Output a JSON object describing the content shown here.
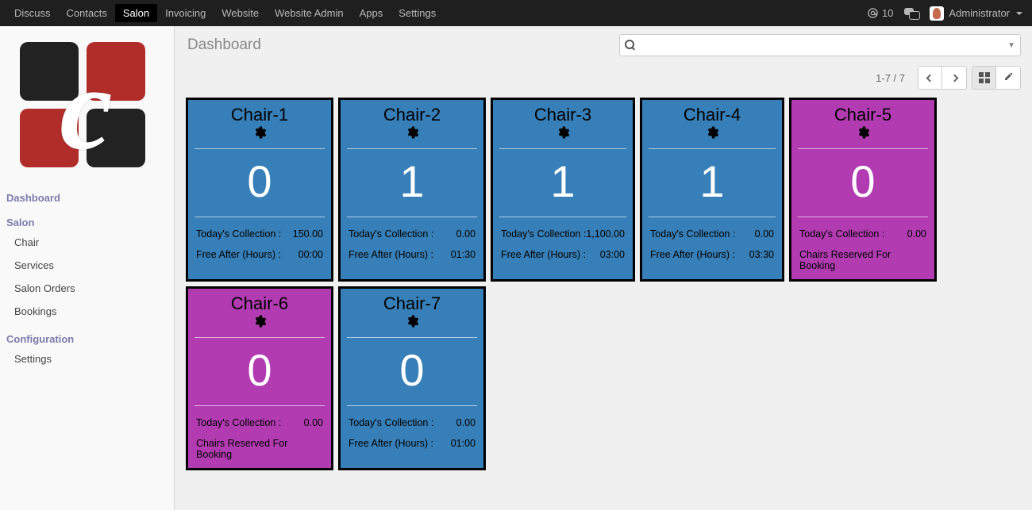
{
  "nav": {
    "items": [
      "Discuss",
      "Contacts",
      "Salon",
      "Invoicing",
      "Website",
      "Website Admin",
      "Apps",
      "Settings"
    ],
    "active": "Salon",
    "notifications": "10",
    "user": "Administrator"
  },
  "sidebar": {
    "sections": [
      {
        "label": "Dashboard"
      },
      {
        "label": "Salon",
        "items": [
          "Chair",
          "Services",
          "Salon Orders",
          "Bookings"
        ]
      },
      {
        "label": "Configuration",
        "items": [
          "Settings"
        ]
      }
    ]
  },
  "header": {
    "title": "Dashboard",
    "search": {
      "placeholder": ""
    }
  },
  "pager": "1-7 / 7",
  "cards": [
    {
      "name": "Chair-1",
      "count": "0",
      "collection": "150.00",
      "free_after": "00:00",
      "reserved": false,
      "color": "blue"
    },
    {
      "name": "Chair-2",
      "count": "1",
      "collection": "0.00",
      "free_after": "01:30",
      "reserved": false,
      "color": "blue"
    },
    {
      "name": "Chair-3",
      "count": "1",
      "collection": "1,100.00",
      "free_after": "03:00",
      "reserved": false,
      "color": "blue"
    },
    {
      "name": "Chair-4",
      "count": "1",
      "collection": "0.00",
      "free_after": "03:30",
      "reserved": false,
      "color": "blue"
    },
    {
      "name": "Chair-5",
      "count": "0",
      "collection": "0.00",
      "free_after": "",
      "reserved": true,
      "color": "purple"
    },
    {
      "name": "Chair-6",
      "count": "0",
      "collection": "0.00",
      "free_after": "",
      "reserved": true,
      "color": "purple"
    },
    {
      "name": "Chair-7",
      "count": "0",
      "collection": "0.00",
      "free_after": "01:00",
      "reserved": false,
      "color": "blue"
    }
  ],
  "labels": {
    "collection": "Today's Collection :",
    "free_after": "Free After (Hours) :",
    "reserved": "Chairs Reserved For Booking"
  }
}
